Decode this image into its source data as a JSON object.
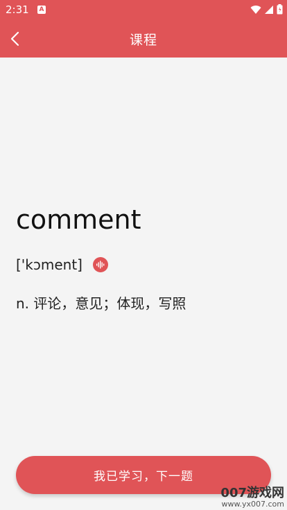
{
  "status_bar": {
    "time": "2:31",
    "icons": [
      "a-notification-icon",
      "wifi-icon",
      "cellular-icon",
      "battery-icon"
    ]
  },
  "header": {
    "title": "课程",
    "back_icon": "chevron-left-icon"
  },
  "card": {
    "word": "comment",
    "phonetic": "['kɔment]",
    "audio_icon": "audio-wave-icon",
    "definition": "n. 评论，意见；体现，写照"
  },
  "footer": {
    "button_label": "我已学习，下一题"
  },
  "watermark": {
    "brand": "007游戏网",
    "url": "www.yx007.com"
  },
  "colors": {
    "accent": "#e05457",
    "background": "#f4f4f4"
  }
}
